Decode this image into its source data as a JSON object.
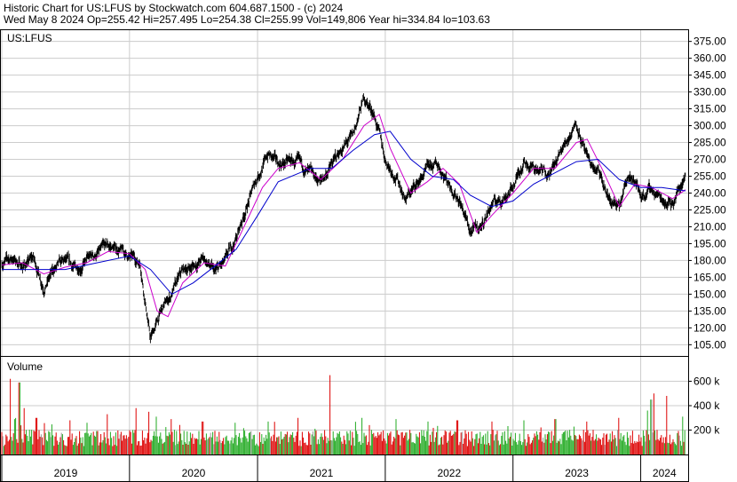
{
  "header": {
    "line1": "Historic Chart for US:LFUS by Stockwatch.com 604.687.1500 - (c) 2024",
    "line2": "Wed May  8 2024   Op=255.42   Hi=257.495   Lo=254.38   Cl=255.99   Vol=149,806   Year hi=334.84   lo=103.63"
  },
  "colors": {
    "price": "#000000",
    "ma_short": "#cc00cc",
    "ma_long": "#0000cc",
    "vol_up": "#22aa22",
    "vol_down": "#dd0000",
    "vol_neutral": "#999999",
    "grid": "#cccccc"
  },
  "chart_data": [
    {
      "type": "line",
      "title": "US:LFUS",
      "ylim": [
        95,
        385
      ],
      "y_ticks": [
        "375.00",
        "360.00",
        "345.00",
        "330.00",
        "315.00",
        "300.00",
        "285.00",
        "270.00",
        "255.00",
        "240.00",
        "225.00",
        "210.00",
        "195.00",
        "180.00",
        "165.00",
        "150.00",
        "135.00",
        "120.00",
        "105.00"
      ],
      "x_ticks": [
        "2019",
        "2020",
        "2021",
        "2022",
        "2023",
        "2024"
      ],
      "x_range": [
        "2019-01-01",
        "2024-05-08"
      ],
      "series": [
        {
          "kind": "price",
          "points": [
            [
              "2019-01-01",
              178
            ],
            [
              "2019-02-01",
              182
            ],
            [
              "2019-03-01",
              175
            ],
            [
              "2019-04-01",
              182
            ],
            [
              "2019-05-01",
              157
            ],
            [
              "2019-06-01",
              172
            ],
            [
              "2019-07-01",
              178
            ],
            [
              "2019-08-01",
              172
            ],
            [
              "2019-09-01",
              180
            ],
            [
              "2019-10-01",
              186
            ],
            [
              "2019-11-01",
              192
            ],
            [
              "2019-12-01",
              190
            ],
            [
              "2020-01-01",
              183
            ],
            [
              "2020-02-01",
              178
            ],
            [
              "2020-03-01",
              110
            ],
            [
              "2020-04-01",
              135
            ],
            [
              "2020-05-01",
              150
            ],
            [
              "2020-06-01",
              170
            ],
            [
              "2020-07-01",
              175
            ],
            [
              "2020-08-01",
              182
            ],
            [
              "2020-09-01",
              168
            ],
            [
              "2020-10-01",
              178
            ],
            [
              "2020-11-01",
              200
            ],
            [
              "2020-12-01",
              228
            ],
            [
              "2021-01-01",
              255
            ],
            [
              "2021-02-01",
              275
            ],
            [
              "2021-03-01",
              265
            ],
            [
              "2021-04-01",
              268
            ],
            [
              "2021-05-01",
              265
            ],
            [
              "2021-06-01",
              255
            ],
            [
              "2021-07-01",
              250
            ],
            [
              "2021-08-01",
              265
            ],
            [
              "2021-09-01",
              280
            ],
            [
              "2021-10-01",
              290
            ],
            [
              "2021-11-01",
              325
            ],
            [
              "2021-12-01",
              310
            ],
            [
              "2022-01-01",
              270
            ],
            [
              "2022-02-01",
              255
            ],
            [
              "2022-03-01",
              235
            ],
            [
              "2022-04-01",
              248
            ],
            [
              "2022-05-01",
              260
            ],
            [
              "2022-06-01",
              265
            ],
            [
              "2022-07-01",
              250
            ],
            [
              "2022-08-01",
              235
            ],
            [
              "2022-09-01",
              205
            ],
            [
              "2022-10-01",
              210
            ],
            [
              "2022-11-01",
              230
            ],
            [
              "2022-12-01",
              235
            ],
            [
              "2023-01-01",
              245
            ],
            [
              "2023-02-01",
              270
            ],
            [
              "2023-03-01",
              262
            ],
            [
              "2023-04-01",
              258
            ],
            [
              "2023-05-01",
              265
            ],
            [
              "2023-06-01",
              285
            ],
            [
              "2023-07-01",
              305
            ],
            [
              "2023-08-01",
              268
            ],
            [
              "2023-09-01",
              258
            ],
            [
              "2023-10-01",
              235
            ],
            [
              "2023-11-01",
              225
            ],
            [
              "2023-12-01",
              260
            ],
            [
              "2024-01-01",
              238
            ],
            [
              "2024-02-01",
              243
            ],
            [
              "2024-03-01",
              235
            ],
            [
              "2024-04-01",
              232
            ],
            [
              "2024-05-08",
              256
            ]
          ]
        },
        {
          "kind": "ma_short",
          "points": [
            [
              "2019-01-01",
              176
            ],
            [
              "2019-03-01",
              178
            ],
            [
              "2019-05-01",
              168
            ],
            [
              "2019-07-01",
              174
            ],
            [
              "2019-09-01",
              178
            ],
            [
              "2019-11-01",
              188
            ],
            [
              "2020-01-01",
              186
            ],
            [
              "2020-02-15",
              172
            ],
            [
              "2020-03-20",
              135
            ],
            [
              "2020-04-20",
              130
            ],
            [
              "2020-06-01",
              160
            ],
            [
              "2020-08-01",
              178
            ],
            [
              "2020-10-01",
              175
            ],
            [
              "2020-12-01",
              215
            ],
            [
              "2021-01-15",
              245
            ],
            [
              "2021-03-01",
              262
            ],
            [
              "2021-05-01",
              267
            ],
            [
              "2021-07-01",
              252
            ],
            [
              "2021-09-01",
              270
            ],
            [
              "2021-11-01",
              300
            ],
            [
              "2021-12-15",
              310
            ],
            [
              "2022-01-15",
              280
            ],
            [
              "2022-03-15",
              240
            ],
            [
              "2022-05-01",
              250
            ],
            [
              "2022-06-15",
              262
            ],
            [
              "2022-08-01",
              248
            ],
            [
              "2022-09-20",
              205
            ],
            [
              "2022-11-01",
              220
            ],
            [
              "2023-01-01",
              240
            ],
            [
              "2023-03-01",
              262
            ],
            [
              "2023-05-01",
              262
            ],
            [
              "2023-07-01",
              285
            ],
            [
              "2023-08-01",
              288
            ],
            [
              "2023-09-15",
              260
            ],
            [
              "2023-11-01",
              228
            ],
            [
              "2023-12-15",
              248
            ],
            [
              "2024-02-01",
              245
            ],
            [
              "2024-04-01",
              235
            ],
            [
              "2024-05-08",
              243
            ]
          ]
        },
        {
          "kind": "ma_long",
          "points": [
            [
              "2019-01-01",
              172
            ],
            [
              "2019-04-01",
              172
            ],
            [
              "2019-07-01",
              172
            ],
            [
              "2019-10-01",
              178
            ],
            [
              "2020-01-01",
              184
            ],
            [
              "2020-03-01",
              172
            ],
            [
              "2020-05-01",
              150
            ],
            [
              "2020-07-01",
              160
            ],
            [
              "2020-09-01",
              175
            ],
            [
              "2020-11-01",
              190
            ],
            [
              "2021-01-01",
              220
            ],
            [
              "2021-03-01",
              250
            ],
            [
              "2021-06-01",
              262
            ],
            [
              "2021-08-01",
              262
            ],
            [
              "2021-10-01",
              278
            ],
            [
              "2021-12-01",
              292
            ],
            [
              "2022-01-15",
              295
            ],
            [
              "2022-03-15",
              270
            ],
            [
              "2022-05-15",
              255
            ],
            [
              "2022-07-15",
              252
            ],
            [
              "2022-09-01",
              238
            ],
            [
              "2022-11-01",
              228
            ],
            [
              "2023-01-01",
              233
            ],
            [
              "2023-03-01",
              248
            ],
            [
              "2023-05-01",
              258
            ],
            [
              "2023-07-01",
              268
            ],
            [
              "2023-09-01",
              270
            ],
            [
              "2023-11-01",
              252
            ],
            [
              "2024-01-01",
              245
            ],
            [
              "2024-03-01",
              245
            ],
            [
              "2024-05-08",
              242
            ]
          ]
        }
      ]
    },
    {
      "type": "bar",
      "title": "Volume",
      "ylim": [
        0,
        800000
      ],
      "y_ticks": [
        "600 k",
        "400 k",
        "200 k"
      ],
      "x_range": [
        "2019-01-01",
        "2024-05-08"
      ],
      "series": [
        {
          "kind": "volume",
          "base_level": 150000,
          "spikes": [
            [
              "2019-01-25",
              620000
            ],
            [
              "2019-02-20",
              590000
            ],
            [
              "2019-03-05",
              380000
            ],
            [
              "2019-04-10",
              300000
            ],
            [
              "2019-07-15",
              280000
            ],
            [
              "2019-09-01",
              260000
            ],
            [
              "2019-10-30",
              330000
            ],
            [
              "2020-01-20",
              380000
            ],
            [
              "2020-02-25",
              350000
            ],
            [
              "2020-03-18",
              310000
            ],
            [
              "2020-04-28",
              290000
            ],
            [
              "2020-07-28",
              270000
            ],
            [
              "2020-10-28",
              260000
            ],
            [
              "2021-02-01",
              270000
            ],
            [
              "2021-04-27",
              300000
            ],
            [
              "2021-07-27",
              650000
            ],
            [
              "2021-10-26",
              300000
            ],
            [
              "2022-02-01",
              290000
            ],
            [
              "2022-05-03",
              270000
            ],
            [
              "2022-07-26",
              280000
            ],
            [
              "2022-11-01",
              270000
            ],
            [
              "2023-01-31",
              280000
            ],
            [
              "2023-05-02",
              290000
            ],
            [
              "2023-08-01",
              270000
            ],
            [
              "2023-10-31",
              300000
            ],
            [
              "2024-01-20",
              360000
            ],
            [
              "2024-01-31",
              450000
            ],
            [
              "2024-02-08",
              500000
            ],
            [
              "2024-03-15",
              480000
            ],
            [
              "2024-04-30",
              310000
            ]
          ]
        }
      ]
    }
  ]
}
